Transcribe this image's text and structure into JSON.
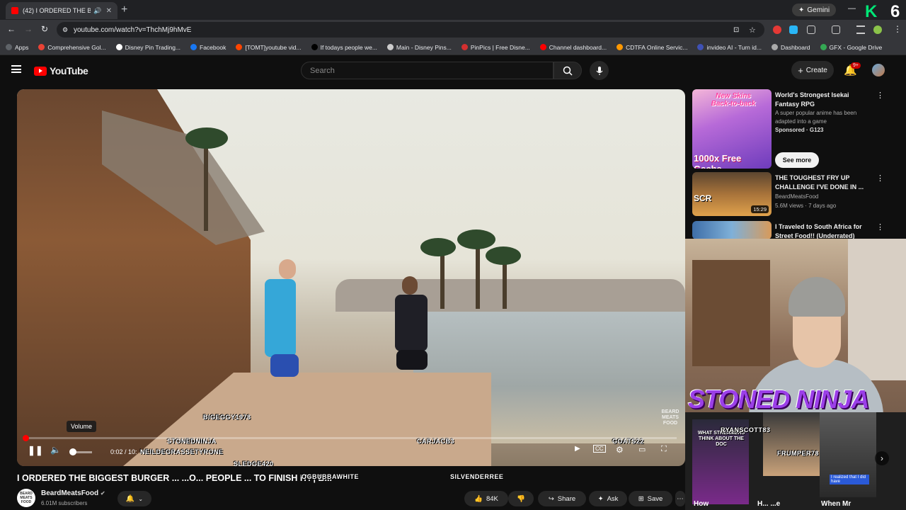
{
  "browser": {
    "tab_title": "(42) I ORDERED THE BIGGE",
    "new_tab": "+",
    "gemini_label": "Gemini",
    "url": "youtube.com/watch?v=ThchMj9hMvE",
    "overlay_k": "K",
    "overlay_6": "6",
    "bookmarks": [
      {
        "label": "Apps",
        "color": "#5f6368"
      },
      {
        "label": "Comprehensive Gol...",
        "color": "#ea4335"
      },
      {
        "label": "Disney Pin Trading...",
        "color": "#ffffff"
      },
      {
        "label": "Facebook",
        "color": "#1877f2"
      },
      {
        "label": "[TOMT]youtube vid...",
        "color": "#ff4500"
      },
      {
        "label": "If todays people we...",
        "color": "#000000"
      },
      {
        "label": "Main - Disney Pins...",
        "color": "#cccccc"
      },
      {
        "label": "PinPics | Free Disne...",
        "color": "#d32f2f"
      },
      {
        "label": "Channel dashboard...",
        "color": "#ff0000"
      },
      {
        "label": "CDTFA Online Servic...",
        "color": "#ff9800"
      },
      {
        "label": "invideo AI - Turn id...",
        "color": "#3f51b5"
      },
      {
        "label": "Dashboard",
        "color": "#aaaaaa"
      },
      {
        "label": "GFX - Google Drive",
        "color": "#34a853"
      }
    ]
  },
  "youtube": {
    "logo_text": "YouTube",
    "search_placeholder": "Search",
    "create_label": "Create",
    "notif_badge": "9+"
  },
  "player": {
    "volume_tooltip": "Volume",
    "time": "0:02 / 10:",
    "progress_fraction": 0.003,
    "watermark": "BEARD MEATS FOOD",
    "chat_overlays": [
      {
        "name": "BIGEGGY1978"
      },
      {
        "name": "STONEDNINJA"
      },
      {
        "name": "NEILDEGRASSETYRONE"
      },
      {
        "name": "SLEDGE420"
      },
      {
        "name": "CARJACB3"
      },
      {
        "name": "GOATS22"
      },
      {
        "name": "OGBUBBAWHITE"
      },
      {
        "name": "SILVENDERREE"
      }
    ]
  },
  "video": {
    "title": "I ORDERED THE BIGGEST BURGER ...   ...O...   PEOPLE ...   TO FINISH IT! | B...",
    "channel": "BeardMeatsFood",
    "subscribers": "6.01M subscribers",
    "channel_avatar_text": "BEARD MEATS FOOD",
    "like_count": "84K",
    "share_label": "Share",
    "ask_label": "Ask",
    "save_label": "Save"
  },
  "sidebar": {
    "cards": [
      {
        "title": "World's Strongest Isekai Fantasy RPG",
        "meta1": "A super popular anime has been adapted into a game",
        "meta2": "Sponsored · G123",
        "button": "See more",
        "thumb_text": "1000x Free Gacha",
        "thumb_top_text": "New Skins Back-to-back"
      },
      {
        "title": "THE TOUGHEST FRY UP CHALLENGE I'VE DONE IN ...",
        "meta1": "BeardMeatsFood",
        "meta2": "5.6M views · 7 days ago",
        "duration": "15:29",
        "thumb_text": "SCR"
      },
      {
        "title": "I Traveled to South Africa for Street Food!! (Underrated)",
        "meta1": "",
        "meta2": ""
      }
    ]
  },
  "webcam": {
    "banner": "STONED NINJA",
    "chat_names": [
      "RYANSCOTT83",
      "FRUMPER78"
    ],
    "small_caption": "WHAT STREAMERS THINK ABOUT THE DOC",
    "tile_caption": "I realized that I did have",
    "cut_labels": [
      "How",
      "H... ...e",
      "When Mr"
    ]
  }
}
